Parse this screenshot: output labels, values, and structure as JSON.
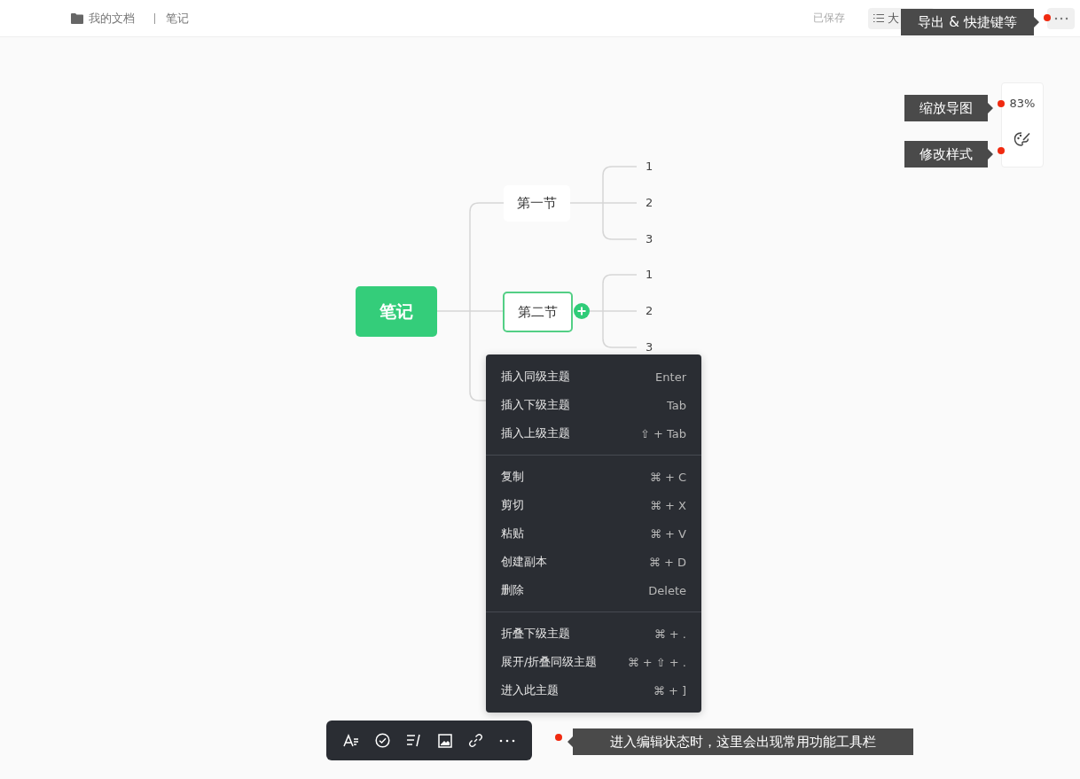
{
  "breadcrumb": {
    "folder": "我的文档",
    "document": "笔记"
  },
  "status": "已保存",
  "outline_button": {
    "label": "大"
  },
  "tooltips": [
    {
      "text": "导出 & 快捷键等",
      "kind": "top"
    },
    {
      "text": "缩放导图",
      "kind": "zoom"
    },
    {
      "text": "修改样式",
      "kind": "style"
    },
    {
      "text": "进入编辑状态时，这里会出现常用功能工具栏",
      "kind": "toolbar"
    }
  ],
  "zoom_panel": {
    "zoom": "83%"
  },
  "mindmap": {
    "root": {
      "label": "笔记",
      "children": [
        {
          "label": "第一节",
          "selected": false,
          "children": [
            {
              "label": "1"
            },
            {
              "label": "2"
            },
            {
              "label": "3"
            }
          ]
        },
        {
          "label": "第二节",
          "selected": true,
          "children": [
            {
              "label": "1"
            },
            {
              "label": "2"
            },
            {
              "label": "3"
            }
          ]
        }
      ]
    }
  },
  "context_menu": [
    [
      {
        "label": "插入同级主题",
        "shortcut": "Enter"
      },
      {
        "label": "插入下级主题",
        "shortcut": "Tab"
      },
      {
        "label": "插入上级主题",
        "shortcut": "⇧ + Tab"
      }
    ],
    [
      {
        "label": "复制",
        "shortcut": "⌘ + C"
      },
      {
        "label": "剪切",
        "shortcut": "⌘ + X"
      },
      {
        "label": "粘贴",
        "shortcut": "⌘ + V"
      },
      {
        "label": "创建副本",
        "shortcut": "⌘ + D"
      },
      {
        "label": "删除",
        "shortcut": "Delete"
      }
    ],
    [
      {
        "label": "折叠下级主题",
        "shortcut": "⌘ + ."
      },
      {
        "label": "展开/折叠同级主题",
        "shortcut": "⌘ + ⇧ + ."
      },
      {
        "label": "进入此主题",
        "shortcut": "⌘ + ]"
      }
    ]
  ]
}
